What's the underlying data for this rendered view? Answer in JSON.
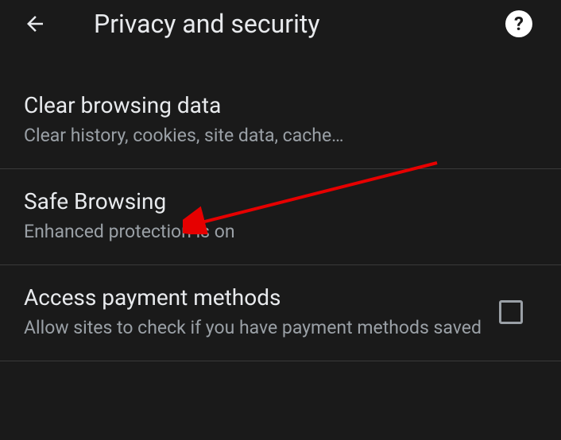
{
  "header": {
    "title": "Privacy and security"
  },
  "settings": {
    "clearBrowsing": {
      "title": "Clear browsing data",
      "subtitle": "Clear history, cookies, site data, cache…"
    },
    "safeBrowsing": {
      "title": "Safe Browsing",
      "subtitle": "Enhanced protection is on"
    },
    "paymentMethods": {
      "title": "Access payment methods",
      "subtitle": "Allow sites to check if you have payment methods saved"
    }
  }
}
